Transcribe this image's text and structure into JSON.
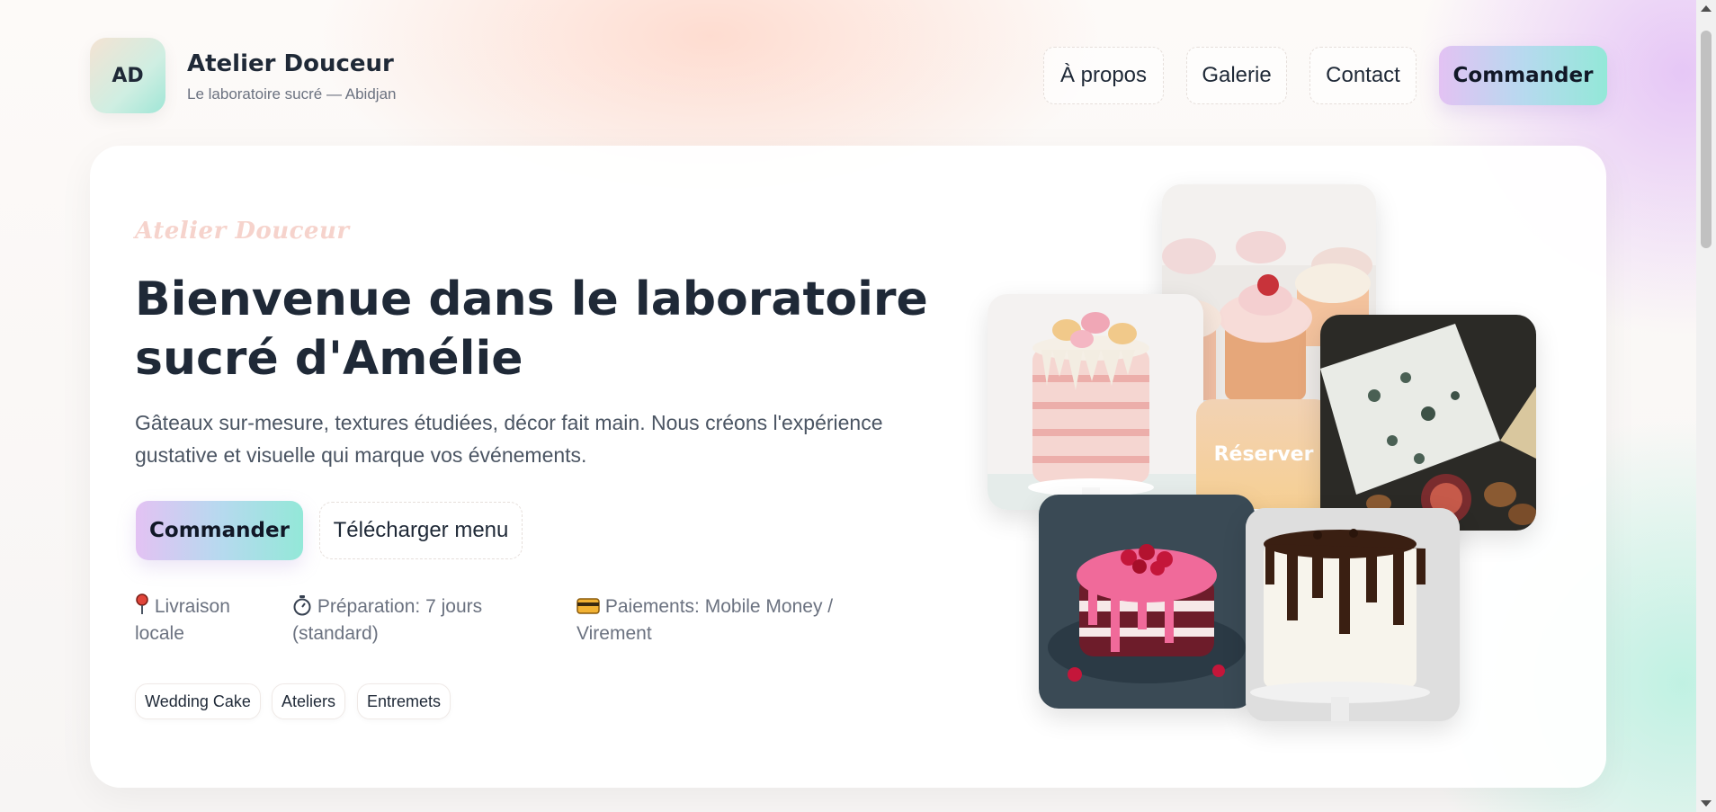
{
  "brand": {
    "initials": "AD",
    "name": "Atelier Douceur",
    "subtitle": "Le laboratoire sucré — Abidjan"
  },
  "nav": {
    "items": [
      {
        "label": "À propos"
      },
      {
        "label": "Galerie"
      },
      {
        "label": "Contact"
      }
    ],
    "cta_label": "Commander"
  },
  "hero": {
    "script_title": "Atelier Douceur",
    "title": "Bienvenue dans le laboratoire sucré d'Amélie",
    "lead": "Gâteaux sur-mesure, textures étudiées, décor fait main. Nous créons l'expérience gustative et visuelle qui marque vos événements.",
    "primary_label": "Commander",
    "secondary_label": "Télécharger menu",
    "info": [
      {
        "icon": "pin-icon",
        "text": "Livraison locale"
      },
      {
        "icon": "stopwatch-icon",
        "text": "Préparation: 7 jours (standard)"
      },
      {
        "icon": "credit-card-icon",
        "text": "Paiements: Mobile Money / Virement"
      }
    ],
    "tags": [
      "Wedding Cake",
      "Ateliers",
      "Entremets"
    ]
  },
  "gallery": {
    "reserve_label": "Réserver",
    "images": [
      {
        "name": "cupcakes-photo"
      },
      {
        "name": "macaron-drip-cake-photo"
      },
      {
        "name": "blue-cheese-fig-photo"
      },
      {
        "name": "raspberry-layer-cake-photo"
      },
      {
        "name": "chocolate-drip-cake-photo"
      }
    ]
  },
  "colors": {
    "accent_gradient_start": "#e3c2f3",
    "accent_gradient_end": "#93e8d8",
    "text_dark": "#1f2937",
    "text_muted": "#6b7280"
  }
}
